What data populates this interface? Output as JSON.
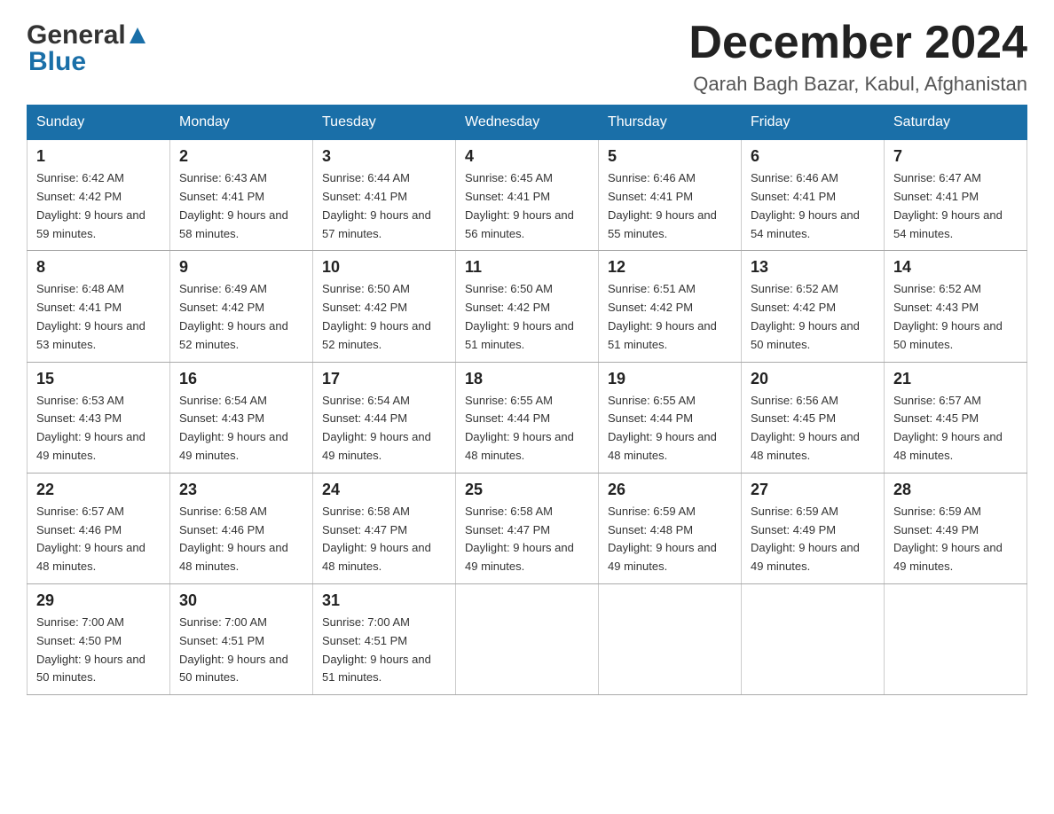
{
  "header": {
    "logo_general": "General",
    "logo_blue": "Blue",
    "month_title": "December 2024",
    "location": "Qarah Bagh Bazar, Kabul, Afghanistan"
  },
  "days_of_week": [
    "Sunday",
    "Monday",
    "Tuesday",
    "Wednesday",
    "Thursday",
    "Friday",
    "Saturday"
  ],
  "weeks": [
    [
      {
        "day": "1",
        "sunrise": "Sunrise: 6:42 AM",
        "sunset": "Sunset: 4:42 PM",
        "daylight": "Daylight: 9 hours and 59 minutes."
      },
      {
        "day": "2",
        "sunrise": "Sunrise: 6:43 AM",
        "sunset": "Sunset: 4:41 PM",
        "daylight": "Daylight: 9 hours and 58 minutes."
      },
      {
        "day": "3",
        "sunrise": "Sunrise: 6:44 AM",
        "sunset": "Sunset: 4:41 PM",
        "daylight": "Daylight: 9 hours and 57 minutes."
      },
      {
        "day": "4",
        "sunrise": "Sunrise: 6:45 AM",
        "sunset": "Sunset: 4:41 PM",
        "daylight": "Daylight: 9 hours and 56 minutes."
      },
      {
        "day": "5",
        "sunrise": "Sunrise: 6:46 AM",
        "sunset": "Sunset: 4:41 PM",
        "daylight": "Daylight: 9 hours and 55 minutes."
      },
      {
        "day": "6",
        "sunrise": "Sunrise: 6:46 AM",
        "sunset": "Sunset: 4:41 PM",
        "daylight": "Daylight: 9 hours and 54 minutes."
      },
      {
        "day": "7",
        "sunrise": "Sunrise: 6:47 AM",
        "sunset": "Sunset: 4:41 PM",
        "daylight": "Daylight: 9 hours and 54 minutes."
      }
    ],
    [
      {
        "day": "8",
        "sunrise": "Sunrise: 6:48 AM",
        "sunset": "Sunset: 4:41 PM",
        "daylight": "Daylight: 9 hours and 53 minutes."
      },
      {
        "day": "9",
        "sunrise": "Sunrise: 6:49 AM",
        "sunset": "Sunset: 4:42 PM",
        "daylight": "Daylight: 9 hours and 52 minutes."
      },
      {
        "day": "10",
        "sunrise": "Sunrise: 6:50 AM",
        "sunset": "Sunset: 4:42 PM",
        "daylight": "Daylight: 9 hours and 52 minutes."
      },
      {
        "day": "11",
        "sunrise": "Sunrise: 6:50 AM",
        "sunset": "Sunset: 4:42 PM",
        "daylight": "Daylight: 9 hours and 51 minutes."
      },
      {
        "day": "12",
        "sunrise": "Sunrise: 6:51 AM",
        "sunset": "Sunset: 4:42 PM",
        "daylight": "Daylight: 9 hours and 51 minutes."
      },
      {
        "day": "13",
        "sunrise": "Sunrise: 6:52 AM",
        "sunset": "Sunset: 4:42 PM",
        "daylight": "Daylight: 9 hours and 50 minutes."
      },
      {
        "day": "14",
        "sunrise": "Sunrise: 6:52 AM",
        "sunset": "Sunset: 4:43 PM",
        "daylight": "Daylight: 9 hours and 50 minutes."
      }
    ],
    [
      {
        "day": "15",
        "sunrise": "Sunrise: 6:53 AM",
        "sunset": "Sunset: 4:43 PM",
        "daylight": "Daylight: 9 hours and 49 minutes."
      },
      {
        "day": "16",
        "sunrise": "Sunrise: 6:54 AM",
        "sunset": "Sunset: 4:43 PM",
        "daylight": "Daylight: 9 hours and 49 minutes."
      },
      {
        "day": "17",
        "sunrise": "Sunrise: 6:54 AM",
        "sunset": "Sunset: 4:44 PM",
        "daylight": "Daylight: 9 hours and 49 minutes."
      },
      {
        "day": "18",
        "sunrise": "Sunrise: 6:55 AM",
        "sunset": "Sunset: 4:44 PM",
        "daylight": "Daylight: 9 hours and 48 minutes."
      },
      {
        "day": "19",
        "sunrise": "Sunrise: 6:55 AM",
        "sunset": "Sunset: 4:44 PM",
        "daylight": "Daylight: 9 hours and 48 minutes."
      },
      {
        "day": "20",
        "sunrise": "Sunrise: 6:56 AM",
        "sunset": "Sunset: 4:45 PM",
        "daylight": "Daylight: 9 hours and 48 minutes."
      },
      {
        "day": "21",
        "sunrise": "Sunrise: 6:57 AM",
        "sunset": "Sunset: 4:45 PM",
        "daylight": "Daylight: 9 hours and 48 minutes."
      }
    ],
    [
      {
        "day": "22",
        "sunrise": "Sunrise: 6:57 AM",
        "sunset": "Sunset: 4:46 PM",
        "daylight": "Daylight: 9 hours and 48 minutes."
      },
      {
        "day": "23",
        "sunrise": "Sunrise: 6:58 AM",
        "sunset": "Sunset: 4:46 PM",
        "daylight": "Daylight: 9 hours and 48 minutes."
      },
      {
        "day": "24",
        "sunrise": "Sunrise: 6:58 AM",
        "sunset": "Sunset: 4:47 PM",
        "daylight": "Daylight: 9 hours and 48 minutes."
      },
      {
        "day": "25",
        "sunrise": "Sunrise: 6:58 AM",
        "sunset": "Sunset: 4:47 PM",
        "daylight": "Daylight: 9 hours and 49 minutes."
      },
      {
        "day": "26",
        "sunrise": "Sunrise: 6:59 AM",
        "sunset": "Sunset: 4:48 PM",
        "daylight": "Daylight: 9 hours and 49 minutes."
      },
      {
        "day": "27",
        "sunrise": "Sunrise: 6:59 AM",
        "sunset": "Sunset: 4:49 PM",
        "daylight": "Daylight: 9 hours and 49 minutes."
      },
      {
        "day": "28",
        "sunrise": "Sunrise: 6:59 AM",
        "sunset": "Sunset: 4:49 PM",
        "daylight": "Daylight: 9 hours and 49 minutes."
      }
    ],
    [
      {
        "day": "29",
        "sunrise": "Sunrise: 7:00 AM",
        "sunset": "Sunset: 4:50 PM",
        "daylight": "Daylight: 9 hours and 50 minutes."
      },
      {
        "day": "30",
        "sunrise": "Sunrise: 7:00 AM",
        "sunset": "Sunset: 4:51 PM",
        "daylight": "Daylight: 9 hours and 50 minutes."
      },
      {
        "day": "31",
        "sunrise": "Sunrise: 7:00 AM",
        "sunset": "Sunset: 4:51 PM",
        "daylight": "Daylight: 9 hours and 51 minutes."
      },
      null,
      null,
      null,
      null
    ]
  ]
}
